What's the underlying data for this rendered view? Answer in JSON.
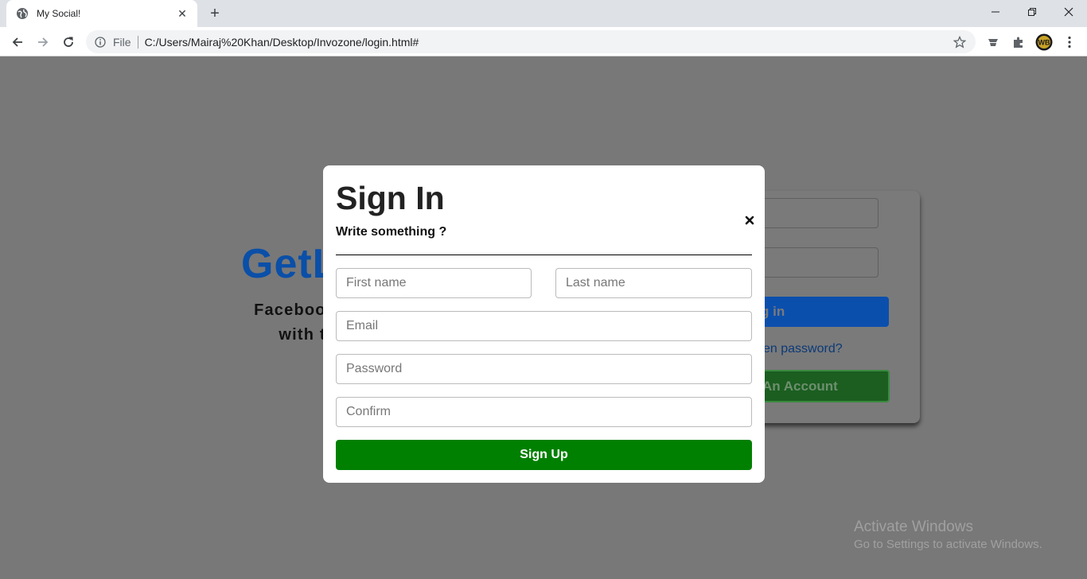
{
  "browser": {
    "tab_title": "My Social!",
    "omnibox_scheme": "File",
    "url": "C:/Users/Mairaj%20Khan/Desktop/Invozone/login.html#"
  },
  "background_page": {
    "brand": "GetL",
    "tagline_line1": "Facebook helps you",
    "tagline_line2": "with the peopl",
    "login_button_label": "g in",
    "forgot_link": "en password?",
    "create_account_label": "An Account"
  },
  "modal": {
    "title": "Sign In",
    "subtitle": "Write something ?",
    "fields": {
      "first_name_placeholder": "First name",
      "last_name_placeholder": "Last name",
      "email_placeholder": "Email",
      "password_placeholder": "Password",
      "confirm_placeholder": "Confirm"
    },
    "submit_label": "Sign Up"
  },
  "watermark": {
    "line1": "Activate Windows",
    "line2": "Go to Settings to activate Windows."
  },
  "colors": {
    "overlay": "#777777",
    "brand_blue": "#0a4fa8",
    "signup_green": "#008000"
  }
}
